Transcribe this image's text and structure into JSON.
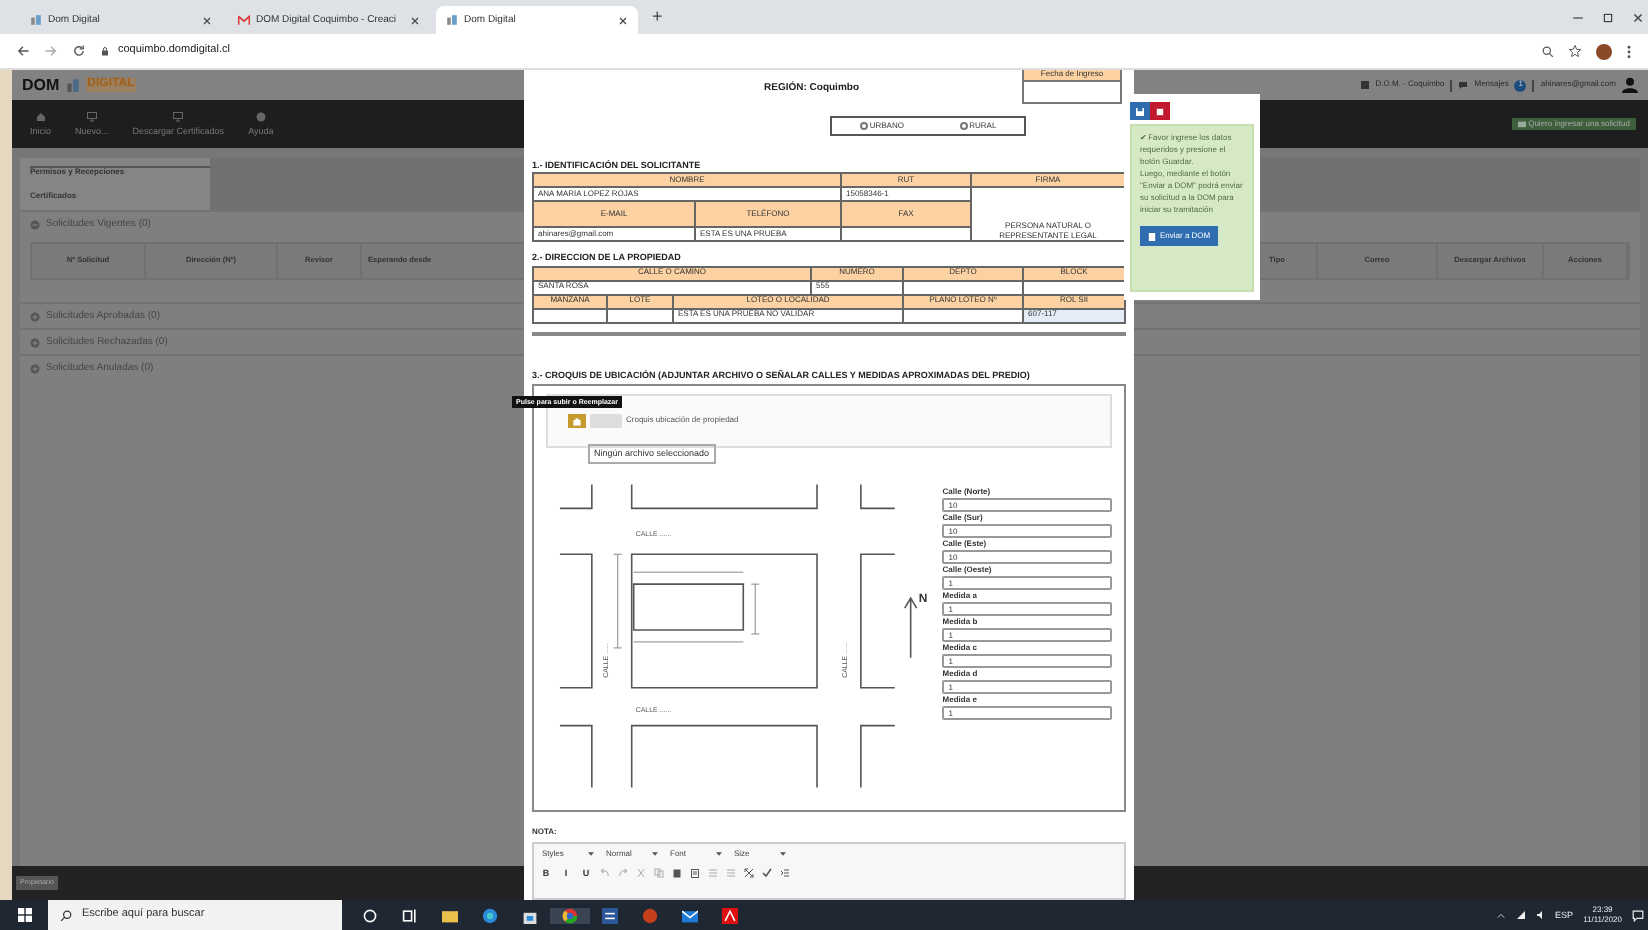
{
  "browser": {
    "tabs": [
      {
        "title": "Dom Digital",
        "kind": "site",
        "selected": false
      },
      {
        "title": "DOM Digital Coquimbo - Creaci",
        "kind": "mail",
        "selected": false
      },
      {
        "title": "Dom Digital",
        "kind": "site",
        "selected": true
      }
    ],
    "new_tab": "+",
    "address": "coquimbo.domdigital.cl"
  },
  "app": {
    "logo": {
      "left": "DOM",
      "right": "DIGITAL"
    },
    "user_bar": {
      "office": "D.O.M. - Coquimbo",
      "messages": "Mensajes",
      "message_count": "1",
      "email": "ahinares@gmail.com"
    },
    "nav": [
      {
        "label": "Inicio",
        "kind": "home"
      },
      {
        "label": "Nuevo...",
        "kind": "monitor"
      },
      {
        "label": "Descargar Certificados",
        "kind": "monitor"
      },
      {
        "label": "Ayuda",
        "kind": "help"
      }
    ],
    "request_button": "Quiero ingresar una solicitud",
    "tabs": [
      {
        "label": "Permisos y Recepciones",
        "selected": true
      },
      {
        "label": "Certificados",
        "selected": false
      }
    ],
    "groups": [
      {
        "title": "Solicitudes Vigentes (0)",
        "expanded": true
      },
      {
        "title": "Solicitudes Aprobadas (0)",
        "expanded": false
      },
      {
        "title": "Solicitudes Rechazadas (0)",
        "expanded": false
      },
      {
        "title": "Solicitudes Anuladas (0)",
        "expanded": false
      }
    ],
    "table_columns": [
      "Nº Solicitud",
      "Dirección (Nº)",
      "Revisor",
      "Esperando desde",
      "Tipo",
      "Correo",
      "Descargar Archivos",
      "Acciones"
    ],
    "role": "Propietario"
  },
  "form": {
    "region": "REGIÓN: Coquimbo",
    "date_label": "Fecha de Ingreso",
    "zone_options": [
      {
        "label": "URBANO",
        "selected": false
      },
      {
        "label": "RURAL",
        "selected": false
      }
    ],
    "section1": {
      "title": "1.- IDENTIFICACIÓN DEL SOLICITANTE",
      "name_label": "NOMBRE",
      "name": "ANA MARIA LOPEZ ROJAS",
      "rut_label": "RUT",
      "rut": "15058346-1",
      "signature_label": "FIRMA",
      "email_label": "E-MAIL",
      "email": "ahinares@gmail.com",
      "phone_label": "TELÉFONO",
      "phone": "ESTA ES UNA PRUEBA",
      "fax_label": "FAX",
      "signature_note": "PERSONA NATURAL O REPRESENTANTE LEGAL"
    },
    "section2": {
      "title": "2.- DIRECCION DE LA PROPIEDAD",
      "street_label": "CALLE O CAMINO",
      "street": "SANTA ROSA",
      "number_label": "NÚMERO",
      "number": "555",
      "unit_label": "DEPTO",
      "block_label": "BLOCK",
      "square_label": "MANZANA",
      "lot_label": "LOTE",
      "locality_label": "LOTEO O LOCALIDAD",
      "locality": "ESTA ES UNA PRUEBA NO VALIDAR",
      "plan_label": "PLANO LOTEO Nº",
      "rol_label": "ROL SII",
      "rol": "607-117"
    },
    "section3": {
      "title": "3.- CROQUIS DE UBICACIÓN (ADJUNTAR ARCHIVO O SEÑALAR CALLES Y MEDIDAS APROXIMADAS DEL PREDIO)",
      "upload_tooltip": "Pulse para subir o Reemplazar",
      "upload_label": "Croquis ubicación de propiedad",
      "file_status": "Ningún archivo seleccionado",
      "street_labels": [
        "CALLE ......",
        "CALLE ......",
        "CALLE ......",
        "CALLE ......"
      ],
      "north": "N",
      "fields": [
        {
          "label": "Calle (Norte)",
          "value": "10"
        },
        {
          "label": "Calle (Sur)",
          "value": "10"
        },
        {
          "label": "Calle (Este)",
          "value": "10"
        },
        {
          "label": "Calle (Oeste)",
          "value": "1"
        },
        {
          "label": "Medida a",
          "value": "1"
        },
        {
          "label": "Medida b",
          "value": "1"
        },
        {
          "label": "Medida c",
          "value": "1"
        },
        {
          "label": "Medida d",
          "value": "1"
        },
        {
          "label": "Medida e",
          "value": "1"
        }
      ]
    },
    "note_label": "NOTA:",
    "editor": {
      "dropdowns": [
        "Styles",
        "Normal",
        "Font",
        "Size"
      ],
      "buttons": [
        {
          "kind": "text",
          "label": "B"
        },
        {
          "kind": "text",
          "label": "I"
        },
        {
          "kind": "text",
          "label": "U"
        },
        {
          "kind": "undo"
        },
        {
          "kind": "redo"
        },
        {
          "kind": "cut"
        },
        {
          "kind": "copy"
        },
        {
          "kind": "paste"
        },
        {
          "kind": "paste-text"
        },
        {
          "kind": "list"
        },
        {
          "kind": "list"
        },
        {
          "kind": "maximize"
        },
        {
          "kind": "check"
        },
        {
          "kind": "indent"
        }
      ]
    }
  },
  "side_panel": {
    "alert": [
      "✔ Favor ingrese los datos requeridos y presione el botón Guardar.",
      "Luego, mediante el botón \"Enviar a DOM\" podrá enviar su solicitud a la DOM para iniciar su tramitación"
    ],
    "send_button": "Enviar a DOM"
  },
  "taskbar": {
    "search": "Escribe aquí para buscar",
    "language": "ESP",
    "time": "23:39",
    "date": "11/11/2020"
  }
}
